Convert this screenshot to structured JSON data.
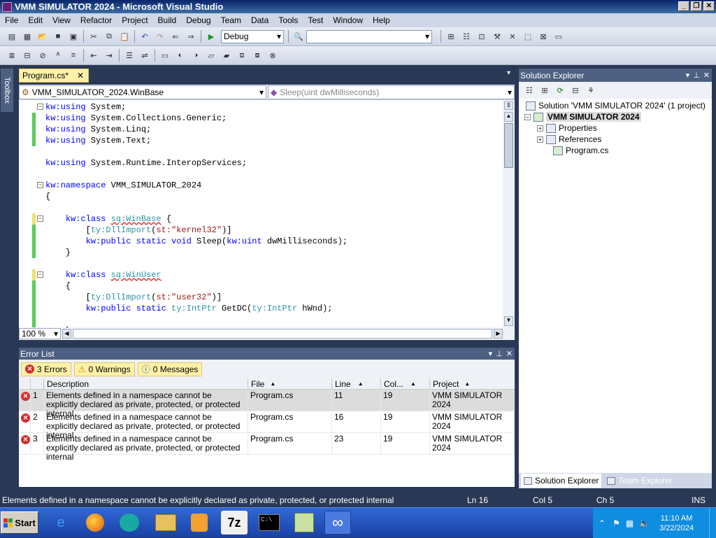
{
  "window": {
    "title": "VMM SIMULATOR 2024 - Microsoft Visual Studio"
  },
  "menu": [
    "File",
    "Edit",
    "View",
    "Refactor",
    "Project",
    "Build",
    "Debug",
    "Team",
    "Data",
    "Tools",
    "Test",
    "Window",
    "Help"
  ],
  "toolbar": {
    "config": "Debug",
    "platform": ""
  },
  "toolbox": {
    "label": "Toolbox"
  },
  "doc": {
    "tab": "Program.cs*",
    "nav_left": "VMM_SIMULATOR_2024.WinBase",
    "nav_right": "Sleep(uint dwMilliseconds)",
    "zoom": "100 %"
  },
  "code": [
    [
      "kw:using",
      " System;"
    ],
    [
      "kw:using",
      " System.Collections.Generic;"
    ],
    [
      "kw:using",
      " System.Linq;"
    ],
    [
      "kw:using",
      " System.Text;"
    ],
    [
      ""
    ],
    [
      "kw:using",
      " System.Runtime.InteropServices;"
    ],
    [
      ""
    ],
    [
      "kw:namespace",
      " VMM_SIMULATOR_2024"
    ],
    [
      "{"
    ],
    [
      ""
    ],
    [
      "    ",
      "kw:class",
      " ",
      "sq:WinBase",
      " {"
    ],
    [
      "        [",
      "ty:DllImport",
      "(",
      "st:\"kernel32\"",
      ")]"
    ],
    [
      "        ",
      "kw:public static void",
      " Sleep(",
      "kw:uint",
      " dwMilliseconds);"
    ],
    [
      "    }"
    ],
    [
      ""
    ],
    [
      "    ",
      "kw:class",
      " ",
      "sq:WinUser"
    ],
    [
      "    {"
    ],
    [
      "        [",
      "ty:DllImport",
      "(",
      "st:\"user32\"",
      ")]"
    ],
    [
      "        ",
      "kw:public static",
      " ",
      "ty:IntPtr",
      " GetDC(",
      "ty:IntPtr",
      " hWnd);"
    ],
    [
      ""
    ],
    [
      "    }"
    ]
  ],
  "solution": {
    "title": "Solution Explorer",
    "solution_node": "Solution 'VMM SIMULATOR 2024' (1 project)",
    "project_node": "VMM SIMULATOR 2024",
    "items": [
      "Properties",
      "References",
      "Program.cs"
    ],
    "tab1": "Solution Explorer",
    "tab2": "Team Explorer"
  },
  "errors": {
    "title": "Error List",
    "filter_errors": "3 Errors",
    "filter_warnings": "0 Warnings",
    "filter_messages": "0 Messages",
    "columns": [
      "Description",
      "File",
      "Line",
      "Col...",
      "Project"
    ],
    "rows": [
      {
        "n": "1",
        "desc": "Elements defined in a namespace cannot be explicitly declared as private, protected, or protected internal",
        "file": "Program.cs",
        "line": "11",
        "col": "19",
        "project": "VMM SIMULATOR 2024"
      },
      {
        "n": "2",
        "desc": "Elements defined in a namespace cannot be explicitly declared as private, protected, or protected internal",
        "file": "Program.cs",
        "line": "16",
        "col": "19",
        "project": "VMM SIMULATOR 2024"
      },
      {
        "n": "3",
        "desc": "Elements defined in a namespace cannot be explicitly declared as private, protected, or protected internal",
        "file": "Program.cs",
        "line": "23",
        "col": "19",
        "project": "VMM SIMULATOR 2024"
      }
    ]
  },
  "status": {
    "message": "Elements defined in a namespace cannot be explicitly declared as private, protected, or protected internal",
    "ln": "Ln 16",
    "col": "Col 5",
    "ch": "Ch 5",
    "mode": "INS"
  },
  "taskbar": {
    "start": "Start",
    "time": "11:10 AM",
    "date": "3/22/2024",
    "app_7z": "7z"
  }
}
